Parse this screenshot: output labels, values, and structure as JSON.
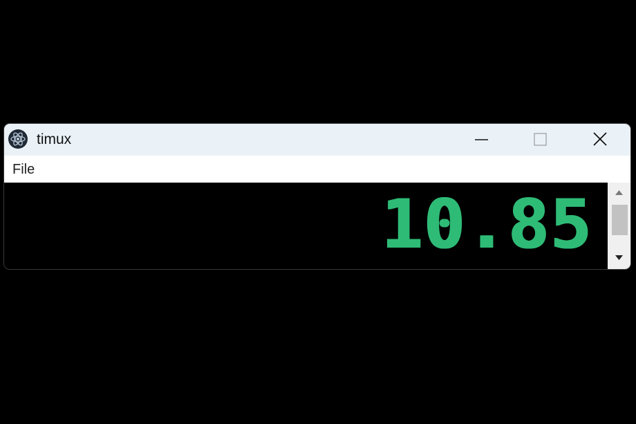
{
  "window": {
    "title": "timux",
    "icon": "electron-atom-icon"
  },
  "titlebar_buttons": {
    "minimize_icon": "minimize-icon",
    "maximize_icon": "maximize-icon",
    "close_icon": "close-icon"
  },
  "menu": {
    "items": [
      {
        "label": "File"
      }
    ]
  },
  "display": {
    "value": "10.85",
    "color": "#2ebb76",
    "background": "#000000"
  },
  "scrollbar": {
    "up_icon": "scroll-up-arrow-icon",
    "down_icon": "scroll-down-arrow-icon"
  }
}
